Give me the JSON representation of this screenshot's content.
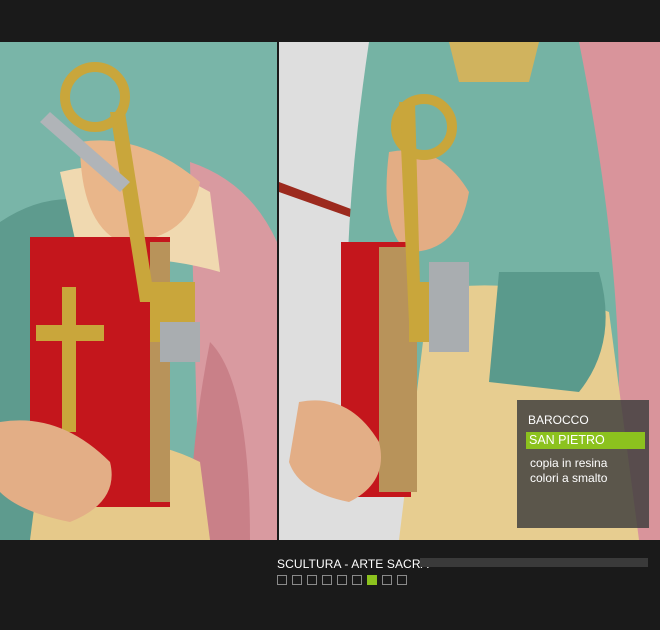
{
  "panel": {
    "style": "BAROCCO",
    "title": "SAN PIETRO",
    "desc_line1": "copia in resina",
    "desc_line2": "colori a smalto"
  },
  "footer": {
    "caption": "SCULTURA - ARTE SACRA",
    "progress": 0,
    "pages": 9,
    "active_page": 7
  },
  "colors": {
    "accent": "#8cc21e",
    "background": "#1a1a1a"
  },
  "images": {
    "left": "statue-detail-left",
    "right": "statue-detail-right"
  }
}
